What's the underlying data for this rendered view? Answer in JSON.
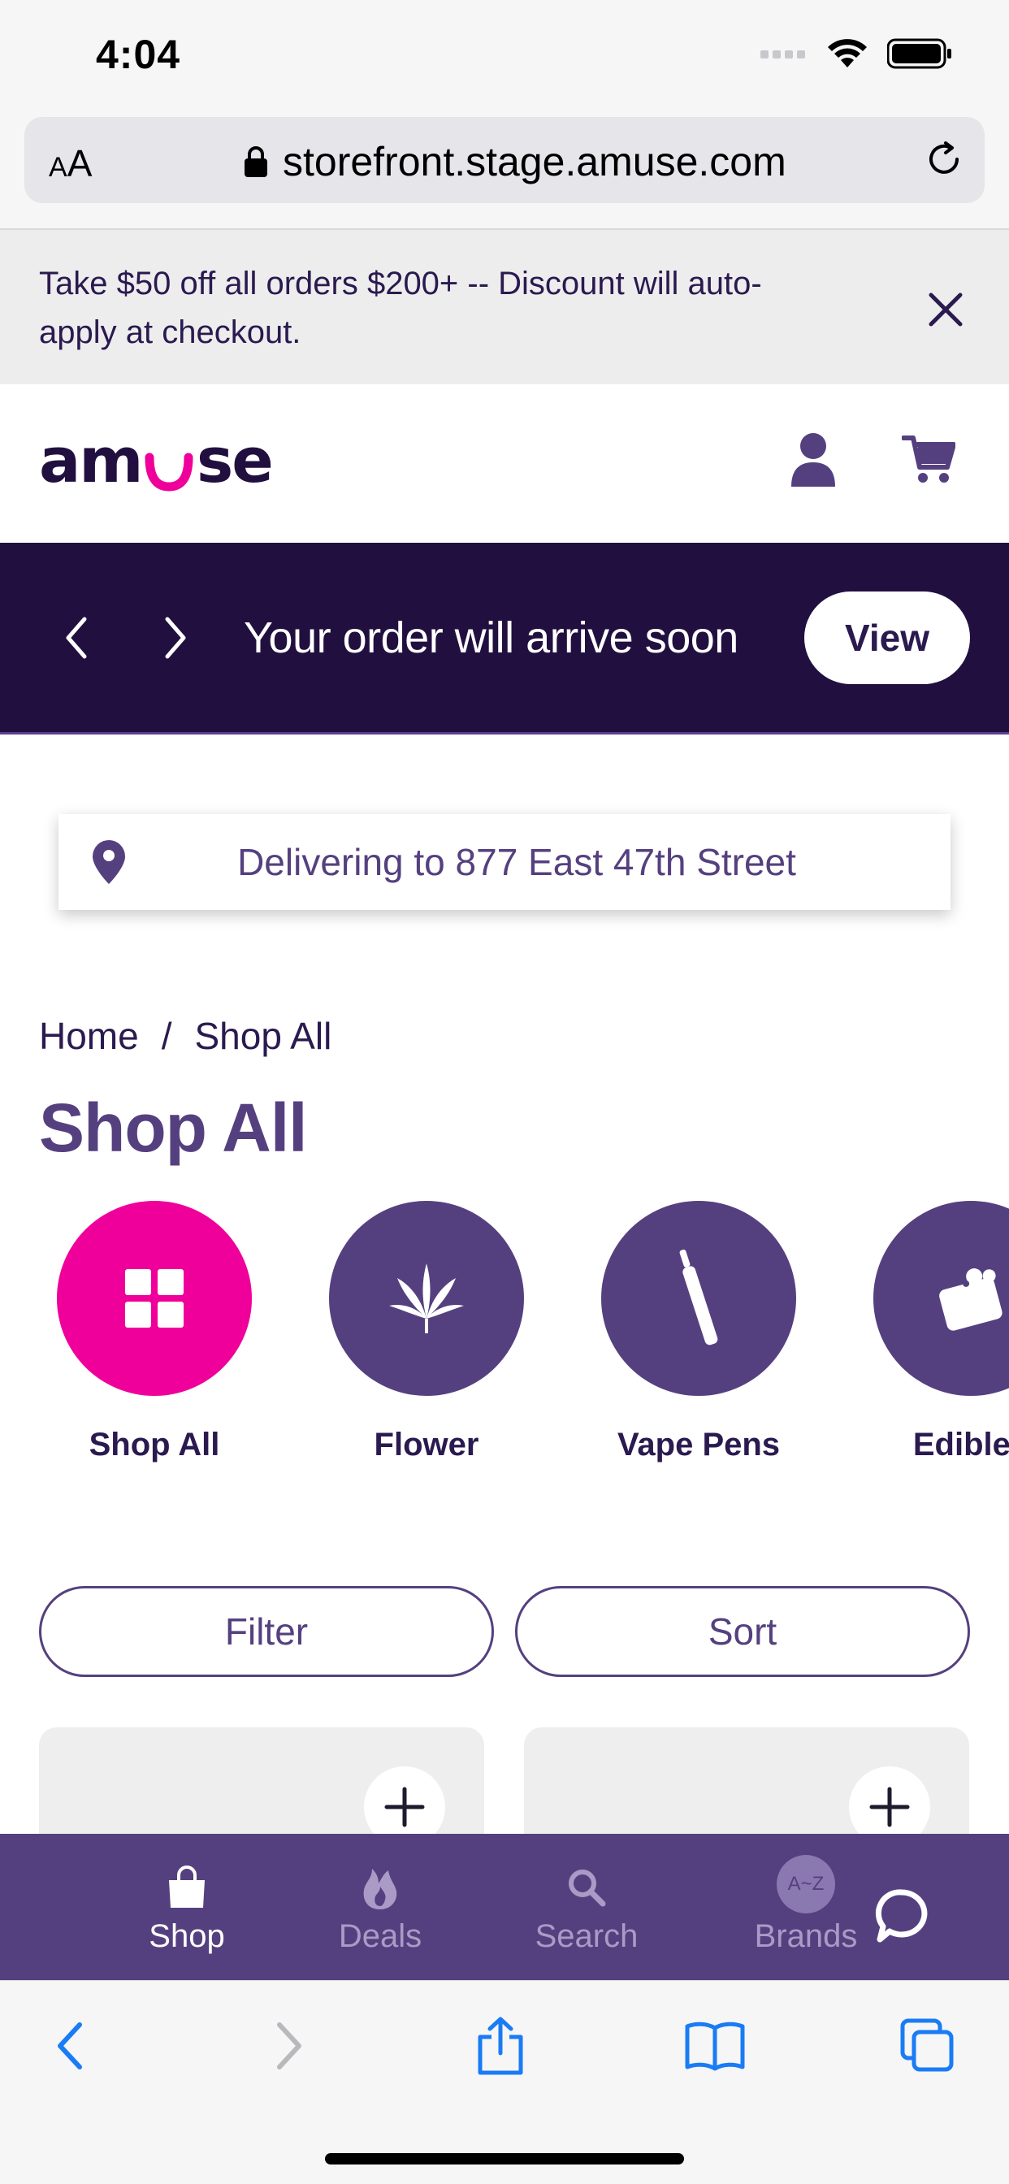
{
  "status_bar": {
    "time": "4:04"
  },
  "browser": {
    "aa_label_small": "A",
    "aa_label_large": "A",
    "url": "storefront.stage.amuse.com"
  },
  "promo": {
    "text": "Take $50 off all orders $200+ -- Discount will auto-apply at checkout."
  },
  "header": {
    "logo_text": "amuse"
  },
  "order_notice": {
    "text": "Your order will arrive soon",
    "button": "View"
  },
  "delivery": {
    "text": "Delivering to 877 East 47th Street"
  },
  "breadcrumb": {
    "home": "Home",
    "separator": "/",
    "current": "Shop All"
  },
  "page_title": "Shop All",
  "categories": [
    {
      "label": "Shop All",
      "icon": "grid-icon",
      "color": "#f0009a"
    },
    {
      "label": "Flower",
      "icon": "cannabis-leaf-icon",
      "color": "#55407f"
    },
    {
      "label": "Vape Pens",
      "icon": "vape-pen-icon",
      "color": "#55407f"
    },
    {
      "label": "Edibles",
      "icon": "edibles-icon",
      "color": "#55407f"
    }
  ],
  "controls": {
    "filter": "Filter",
    "sort": "Sort"
  },
  "tabs": [
    {
      "label": "Shop",
      "icon": "shopping-bag-icon",
      "active": true
    },
    {
      "label": "Deals",
      "icon": "flame-icon",
      "active": false
    },
    {
      "label": "Search",
      "icon": "search-icon",
      "active": false
    },
    {
      "label": "Brands",
      "icon": "a-z-icon",
      "badge": "A~Z",
      "active": false
    }
  ],
  "colors": {
    "brand_purple": "#55407f",
    "dark_purple": "#21103f",
    "accent_pink": "#f0009a",
    "ios_blue": "#1a7cf5"
  }
}
